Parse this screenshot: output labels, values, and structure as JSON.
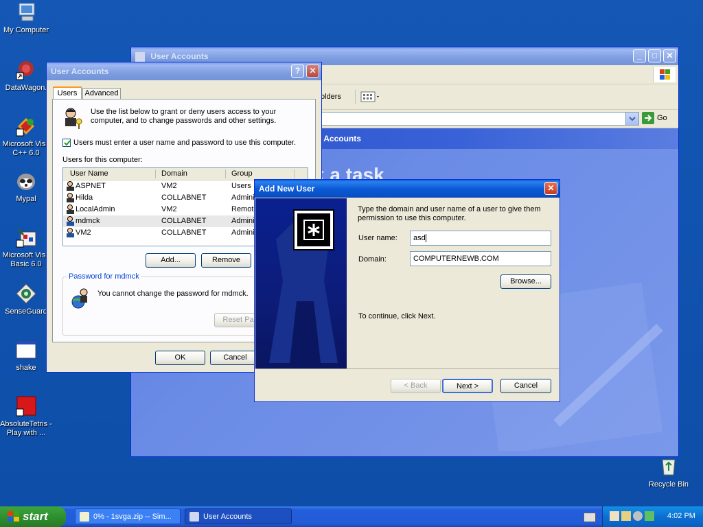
{
  "desktop_icons": [
    {
      "label": "My Computer",
      "icon": "my-computer-icon"
    },
    {
      "label": "DataWagon.",
      "icon": "shortcut-icon"
    },
    {
      "label": "Microsoft Visu C++ 6.0",
      "icon": "visual-cpp-icon"
    },
    {
      "label": "Mypal",
      "icon": "mypal-icon"
    },
    {
      "label": "Microsoft Visu Basic 6.0",
      "icon": "visual-basic-icon"
    },
    {
      "label": "SenseGuard",
      "icon": "senseguard-icon"
    },
    {
      "label": "shake",
      "icon": "window-icon"
    },
    {
      "label": "AbsoluteTetris - Play with ...",
      "icon": "tetris-icon"
    },
    {
      "label": "Recycle Bin",
      "icon": "recycle-bin-icon"
    }
  ],
  "bg_window": {
    "title": "User Accounts",
    "toolbar_folders": "olders",
    "go_label": "Go",
    "side_title": "er Accounts",
    "pick_task": "k a task"
  },
  "ua_dialog": {
    "title": "User Accounts",
    "tabs": [
      "Users",
      "Advanced"
    ],
    "intro": "Use the list below to grant or deny users access to your computer, and to change passwords and other settings.",
    "checkbox_label": "Users must enter a user name and password to use this computer.",
    "checkbox_checked": true,
    "users_label": "Users for this computer:",
    "columns": [
      "User Name",
      "Domain",
      "Group"
    ],
    "rows": [
      {
        "name": "ASPNET",
        "domain": "VM2",
        "group": "Users"
      },
      {
        "name": "Hilda",
        "domain": "COLLABNET",
        "group": "Adminis"
      },
      {
        "name": "LocalAdmin",
        "domain": "VM2",
        "group": "Remote"
      },
      {
        "name": "mdmck",
        "domain": "COLLABNET",
        "group": "Adminis"
      },
      {
        "name": "VM2",
        "domain": "COLLABNET",
        "group": "Adminis"
      }
    ],
    "add_button": "Add...",
    "remove_button": "Remove",
    "password_group": "Password for mdmck",
    "password_text": "You cannot change the password for mdmck.",
    "reset_button": "Reset Pa",
    "ok_button": "OK",
    "cancel_button": "Cancel"
  },
  "add_user": {
    "title": "Add New User",
    "intro": "Type the domain and user name of a user to give them permission to use this computer.",
    "username_label": "User name:",
    "username_value": "asd",
    "domain_label": "Domain:",
    "domain_value": "COMPUTERNEWB.COM",
    "browse_button": "Browse...",
    "continue_text": "To continue, click Next.",
    "back_button": "< Back",
    "next_button": "Next >",
    "cancel_button": "Cancel"
  },
  "taskbar": {
    "start_label": "start",
    "tasks": [
      "0% - 1svga.zip -- Sim...",
      "User Accounts"
    ],
    "clock": "4:02 PM"
  }
}
